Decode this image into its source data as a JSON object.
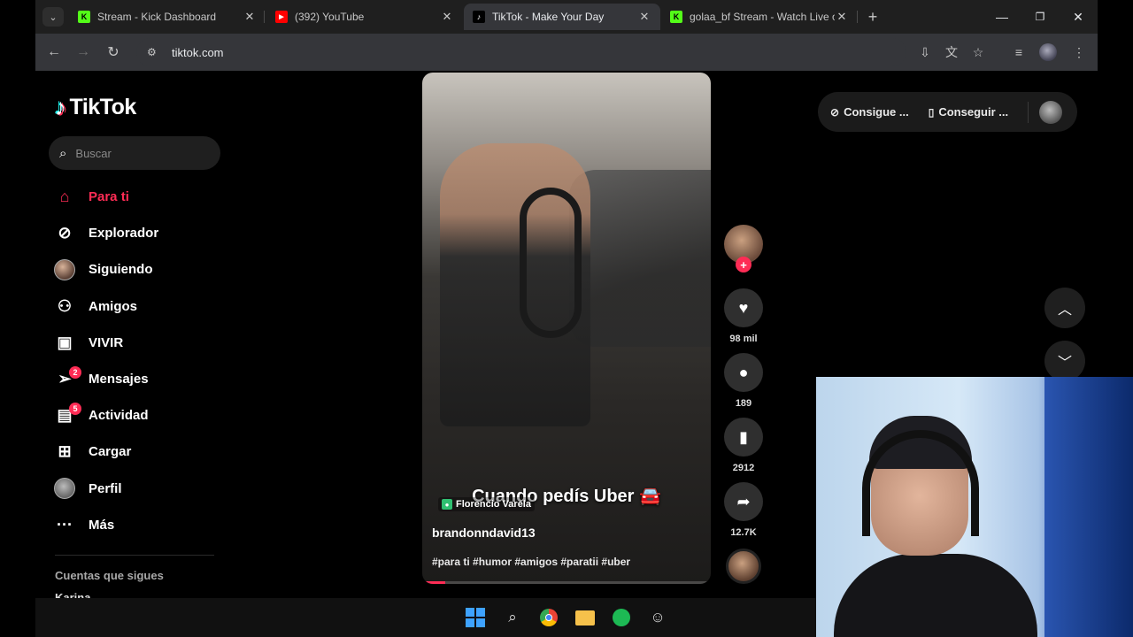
{
  "browser": {
    "tabs": [
      {
        "title": "Stream - Kick Dashboard",
        "favicon": "kick-icon",
        "active": false
      },
      {
        "title": "(392) YouTube",
        "favicon": "youtube-icon",
        "active": false
      },
      {
        "title": "TikTok - Make Your Day",
        "favicon": "tiktok-icon",
        "active": true
      },
      {
        "title": "golaa_bf Stream - Watch Live on Kick",
        "favicon": "kick-icon",
        "active": false
      }
    ],
    "url": "tiktok.com"
  },
  "tiktok": {
    "logo_text": "TikTok",
    "search_placeholder": "Buscar",
    "nav": [
      {
        "label": "Para ti",
        "icon": "home-icon",
        "active": true
      },
      {
        "label": "Explorador",
        "icon": "compass-icon"
      },
      {
        "label": "Siguiendo",
        "icon": "avatar-icon"
      },
      {
        "label": "Amigos",
        "icon": "friends-icon"
      },
      {
        "label": "VIVIR",
        "icon": "live-icon"
      },
      {
        "label": "Mensajes",
        "icon": "messages-icon",
        "badge": "2"
      },
      {
        "label": "Actividad",
        "icon": "activity-icon",
        "badge": "5"
      },
      {
        "label": "Cargar",
        "icon": "upload-icon"
      },
      {
        "label": "Perfil",
        "icon": "profile-avatar-icon"
      },
      {
        "label": "Más",
        "icon": "more-icon"
      }
    ],
    "following_header": "Cuentas que sigues",
    "following_first": "Karina"
  },
  "video": {
    "overlay_caption": "Cuando pedís Uber 🚘",
    "location": "Florencio Varela",
    "author": "brandonndavid13",
    "hashtags": "#para ti #humor #amigos #paratii #uber",
    "progress": 0.08
  },
  "actions": {
    "likes": "98 mil",
    "comments": "189",
    "saves": "2912",
    "shares": "12.7K"
  },
  "get_app": {
    "item1": "Consigue ...",
    "item2": "Conseguir ..."
  }
}
